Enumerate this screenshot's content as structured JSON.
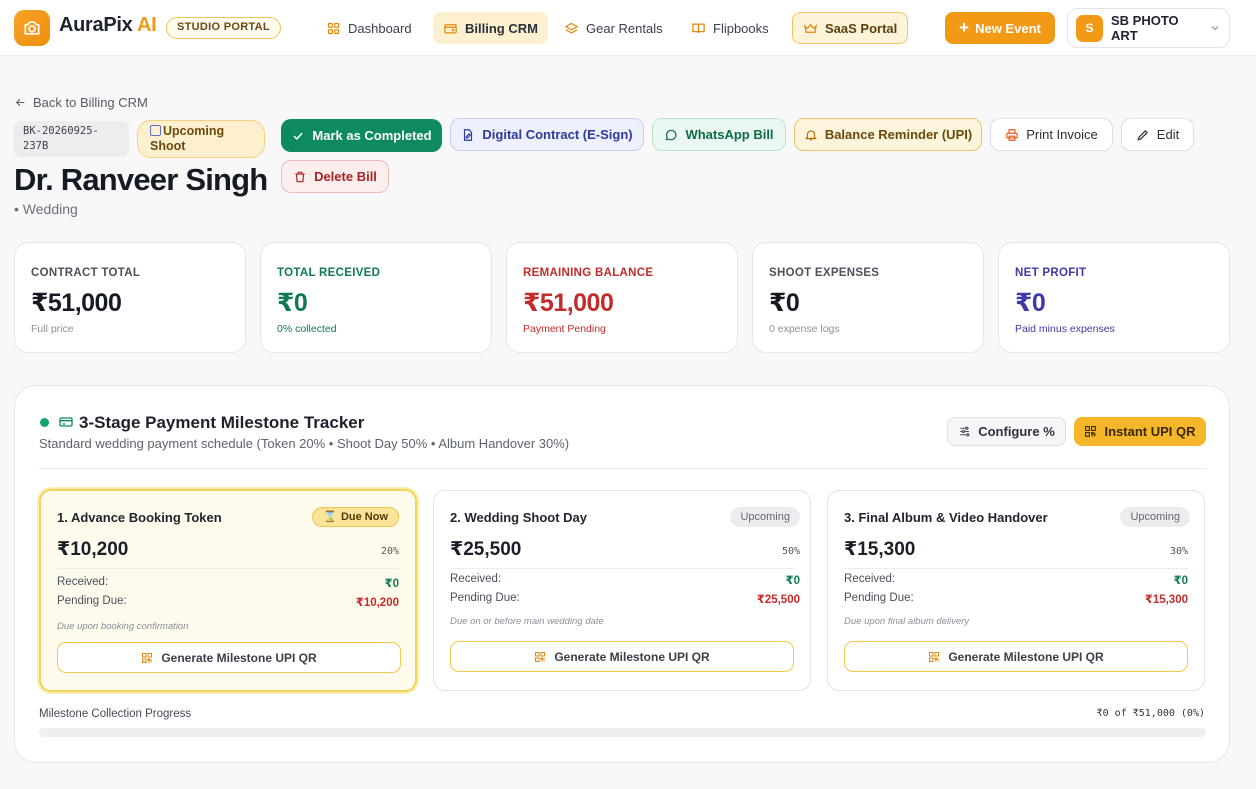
{
  "brand": {
    "name": "AuraPix",
    "suffix": "AI",
    "portal_chip": "STUDIO PORTAL"
  },
  "nav": [
    {
      "label": "Dashboard",
      "icon": "grid-icon"
    },
    {
      "label": "Billing CRM",
      "icon": "wallet-icon",
      "active": true
    },
    {
      "label": "Gear Rentals",
      "icon": "layers-icon"
    },
    {
      "label": "Flipbooks",
      "icon": "book-icon"
    },
    {
      "label": "SaaS Portal",
      "icon": "crown-icon"
    }
  ],
  "actions": {
    "new_event": "New Event"
  },
  "account": {
    "initial": "S",
    "name": "SB PHOTO ART"
  },
  "header": {
    "back_link": "Back to Billing CRM",
    "booking_id_line1": "BK-20260925-",
    "booking_id_line2": "237B",
    "status_line1": "Upcoming",
    "status_line2": "Shoot",
    "client_name": "Dr. Ranveer Singh",
    "event_type": "• Wedding"
  },
  "buttons": {
    "mark_completed": "Mark as Completed",
    "digital_contract": "Digital Contract (E-Sign)",
    "whatsapp_bill": "WhatsApp Bill",
    "balance_reminder": "Balance Reminder (UPI)",
    "print_invoice": "Print Invoice",
    "edit": "Edit",
    "delete_bill": "Delete Bill"
  },
  "stats": [
    {
      "label": "CONTRACT TOTAL",
      "value": "₹51,000",
      "sub": "Full price",
      "label_color": "#4b515c",
      "value_color": "#151a24",
      "sub_color": "#8a8f99"
    },
    {
      "label": "TOTAL RECEIVED",
      "value": "₹0",
      "sub": "0% collected",
      "label_color": "#0f7a52",
      "value_color": "#0f7a52",
      "sub_color": "#0f7a52"
    },
    {
      "label": "REMAINING BALANCE",
      "value": "₹51,000",
      "sub": "Payment Pending",
      "label_color": "#c42b2b",
      "value_color": "#c42b2b",
      "sub_color": "#c42b2b"
    },
    {
      "label": "SHOOT EXPENSES",
      "value": "₹0",
      "sub": "0 expense logs",
      "label_color": "#4b515c",
      "value_color": "#151a24",
      "sub_color": "#8a8f99"
    },
    {
      "label": "NET PROFIT",
      "value": "₹0",
      "sub": "Paid minus expenses",
      "label_color": "#3d3aa8",
      "value_color": "#3d3aa8",
      "sub_color": "#3d3aa8"
    }
  ],
  "milestones_panel": {
    "title": "3-Stage Payment Milestone Tracker",
    "subtitle": "Standard wedding payment schedule (Token 20% • Shoot Day 50% • Album Handover 30%)",
    "configure": "Configure %",
    "instant_qr": "Instant UPI QR",
    "received_label": "Received:",
    "pending_label": "Pending Due:",
    "qr_label": "Generate Milestone UPI QR",
    "items": [
      {
        "title": "1. Advance Booking Token",
        "badge": "Due Now",
        "amount": "₹10,200",
        "percent": "20%",
        "received": "₹0",
        "pending": "₹10,200",
        "note": "Due upon booking confirmation"
      },
      {
        "title": "2. Wedding Shoot Day",
        "badge": "Upcoming",
        "amount": "₹25,500",
        "percent": "50%",
        "received": "₹0",
        "pending": "₹25,500",
        "note": "Due on or before main wedding date"
      },
      {
        "title": "3. Final Album & Video Handover",
        "badge": "Upcoming",
        "amount": "₹15,300",
        "percent": "30%",
        "received": "₹0",
        "pending": "₹15,300",
        "note": "Due upon final album delivery"
      }
    ],
    "progress_label": "Milestone Collection Progress",
    "progress_value": "₹0 of ₹51,000 (0%)",
    "progress_fraction": 0
  },
  "colors": {
    "accent": "#f29a16",
    "success": "#0e8a5f",
    "danger": "#c42b2b",
    "indigo": "#3d3aa8"
  }
}
